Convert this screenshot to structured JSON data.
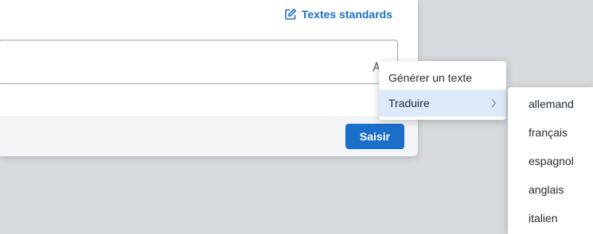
{
  "header": {
    "standard_texts_label": "Textes standards",
    "edit_icon": "edit-square-icon"
  },
  "editor": {
    "ai_icon": "ai-sparkle-icon"
  },
  "footer": {
    "save_label": "Saisir"
  },
  "context_menu": {
    "items": [
      {
        "label": "Générer un texte"
      },
      {
        "label": "Traduire",
        "icon": "chevron-right-icon"
      }
    ]
  },
  "translate_submenu": {
    "items": [
      {
        "label": "allemand"
      },
      {
        "label": "français"
      },
      {
        "label": "espagnol"
      },
      {
        "label": "anglais"
      },
      {
        "label": "italien"
      }
    ]
  },
  "colors": {
    "accent": "#1c6fc9",
    "hover": "#dce9f8",
    "background": "#d6d9dd"
  }
}
